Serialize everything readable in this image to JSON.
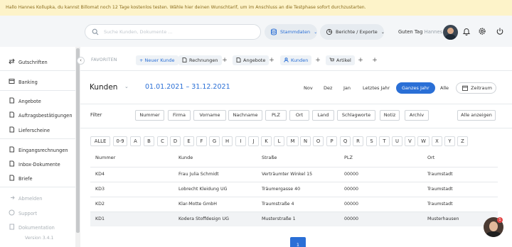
{
  "banner": {
    "text": "Hallo Hannes Kollupka, du kannst Billomat noch 12 Tage kostenlos testen.  Wähle hier deinen Wunschtarif, um im Anschluss an die Testphase sofort durchzustarten."
  },
  "topbar": {
    "search_placeholder": "Suche Kunden, Dokumente ...",
    "stammdaten_label": "Stammdaten",
    "berichte_label": "Berichte / Exporte",
    "greeting": "Guten Tag",
    "user_name": "Hannes"
  },
  "sidebar": {
    "items": [
      {
        "label": "Gutschriften"
      },
      {
        "label": "Banking"
      },
      {
        "label": "Angebote"
      },
      {
        "label": "Auftragsbestätigungen"
      },
      {
        "label": "Lieferscheine"
      },
      {
        "label": "Eingangsrechnungen"
      },
      {
        "label": "Inbox-Dokumente"
      },
      {
        "label": "Briefe"
      },
      {
        "label": "Abmelden"
      },
      {
        "label": "Support"
      },
      {
        "label": "Dokumentation"
      }
    ],
    "version": "Version 3.4.1"
  },
  "favorites": {
    "label": "FAVORITEN",
    "new_customer": "Neuer Kunde",
    "items": [
      "Rechnungen",
      "Angebote",
      "Kunden",
      "Artikel"
    ],
    "plus": "+"
  },
  "header": {
    "title": "Kunden",
    "date_from": "01.01.2021",
    "date_sep": "–",
    "date_to": "31.12.2021",
    "periods": [
      "Nov",
      "Dez",
      "Jan",
      "Letztes Jahr",
      "Ganzes Jahr",
      "Alle"
    ],
    "active_period": "Ganzes Jahr",
    "timespan_label": "Zeitraum"
  },
  "filter": {
    "label": "Filter",
    "fields": [
      "Nummer",
      "Firma",
      "Vorname",
      "Nachname",
      "PLZ",
      "Ort",
      "Land",
      "Schlagworte",
      "Notiz",
      "Archiv"
    ],
    "show_all": "Alle anzeigen"
  },
  "alphabet": [
    "ALLE",
    "0-9",
    "A",
    "B",
    "C",
    "D",
    "E",
    "F",
    "G",
    "H",
    "I",
    "J",
    "K",
    "L",
    "M",
    "N",
    "O",
    "P",
    "Q",
    "R",
    "S",
    "T",
    "U",
    "V",
    "W",
    "X",
    "Y",
    "Z"
  ],
  "table": {
    "columns": [
      "Nummer",
      "Kunde",
      "Straße",
      "PLZ",
      "Ort"
    ],
    "rows": [
      [
        "KD4",
        "Frau Julia Schmidt",
        "Verträumter Winkel 15",
        "00000",
        "Traumstadt"
      ],
      [
        "KD3",
        "Lobrecht Kleidung UG",
        "Träumergasse 40",
        "00000",
        "Traumstadt"
      ],
      [
        "KD2",
        "Klar-Motte GmbH",
        "Traumstraße 4",
        "00000",
        "Traumstadt"
      ],
      [
        "KD1",
        "Kodera Stoffdesign UG",
        "Musterstraße 1",
        "00000",
        "Musterhausen"
      ]
    ]
  },
  "pagination": {
    "current": "1"
  },
  "chat": {
    "badge": "1"
  },
  "colors": {
    "accent": "#2a6fd6",
    "banner_bg": "#fdf3c9",
    "topbar_bg": "#f4f6f8"
  }
}
